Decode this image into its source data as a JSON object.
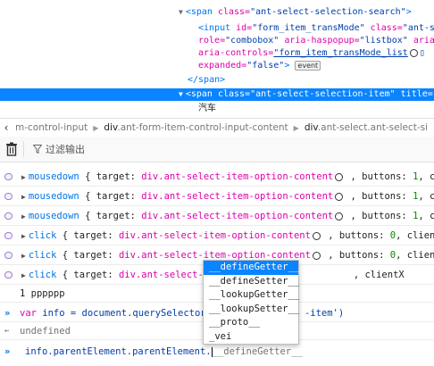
{
  "inspector": {
    "line1": {
      "open": "<span ",
      "attr1": "class=",
      "val1": "\"ant-select-selection-search\"",
      "close": ">"
    },
    "line2": {
      "open": "<input ",
      "attr1": "id=",
      "val1": "\"form_item_transMode\" ",
      "attr2": "class=",
      "val2": "\"ant-s"
    },
    "line3": {
      "attr1": "role=",
      "val1": "\"combobox\" ",
      "attr2": "aria-haspopup=",
      "val2": "\"listbox\" ",
      "attr3": "aria"
    },
    "line4": {
      "attr1": "aria-controls=",
      "val1": "\"form_item_transMode_list",
      "gear": "gear-icon"
    },
    "line5": {
      "attr1": "expanded=",
      "val1": "\"false\"",
      "close": ">",
      "badge": "event"
    },
    "line6": {
      "text": "</span>"
    },
    "line7": {
      "open": "<span ",
      "attr1": "class=",
      "val1": "\"ant-select-selection-item\" ",
      "attr2": "title="
    },
    "line8": {
      "text": "汽车"
    }
  },
  "breadcrumb": {
    "items": [
      {
        "prefix": "m-control-input",
        "bold": ""
      },
      {
        "prefix": "",
        "bold": "div",
        "suffix": ".ant-form-item-control-input-content"
      },
      {
        "prefix": "",
        "bold": "div",
        "suffix": ".ant-select.ant-select-si"
      }
    ]
  },
  "toolbar": {
    "filter_label": "过滤输出"
  },
  "console": {
    "rows": [
      {
        "event": "mousedown",
        "body": "{ target: ",
        "target": "div.ant-select-item-option-content",
        "rest": " , buttons: ",
        "num": "1",
        "tail": ", cli"
      },
      {
        "event": "mousedown",
        "body": "{ target: ",
        "target": "div.ant-select-item-option-content",
        "rest": " , buttons: ",
        "num": "1",
        "tail": ", cli"
      },
      {
        "event": "mousedown",
        "body": "{ target: ",
        "target": "div.ant-select-item-option-content",
        "rest": " , buttons: ",
        "num": "1",
        "tail": ", cli"
      },
      {
        "event": "click",
        "body": "{ target: ",
        "target": "div.ant-select-item-option-content",
        "rest": " , buttons: ",
        "num": "0",
        "tail": ", clientX"
      },
      {
        "event": "click",
        "body": "{ target: ",
        "target": "div.ant-select-item-option-content",
        "rest": " , buttons: ",
        "num": "0",
        "tail": ", clientX"
      },
      {
        "event": "click",
        "body": "{ target: ",
        "target": "div.ant-select-",
        "rest": "",
        "num": "",
        "tail": ", clientX"
      }
    ],
    "log_output": "1 pppppp",
    "input1": {
      "kw": "var",
      "code": " info = document.querySelector(",
      "tail": "-item')"
    },
    "result": "undefined",
    "current_input": "info.parentElement.parentElement.",
    "current_suggest": "__defineGetter__"
  },
  "autocomplete": {
    "items": [
      "__defineGetter__",
      "__defineSetter__",
      "__lookupGetter__",
      "__lookupSetter__",
      "__proto__",
      "_vei"
    ]
  }
}
